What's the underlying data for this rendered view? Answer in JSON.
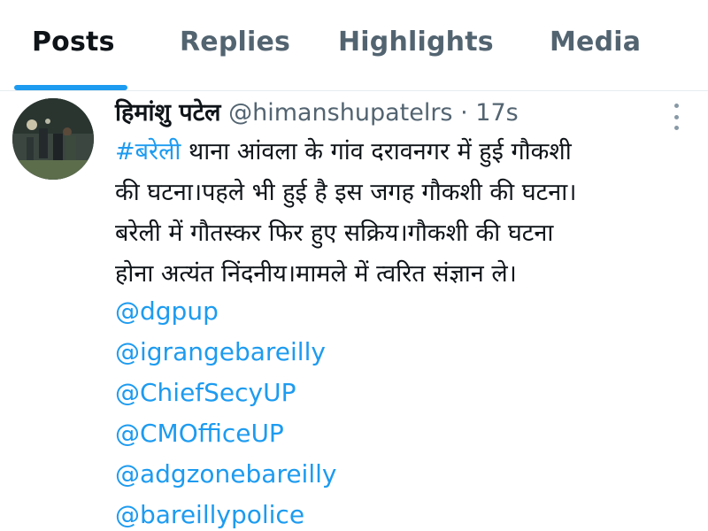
{
  "tabs": [
    {
      "label": "Posts",
      "active": true
    },
    {
      "label": "Replies",
      "active": false
    },
    {
      "label": "Highlights",
      "active": false
    },
    {
      "label": "Media",
      "active": false
    }
  ],
  "tweet": {
    "display_name": "हिमांशु पटेल",
    "handle": "@himanshupatelrs",
    "separator": "·",
    "time": "17s",
    "more_icon": "more-vertical-icon",
    "hashtag": "#बरेली",
    "lines": [
      " थाना आंवला के गांव दरावनगर में हुई गौकशी",
      "की घटना।पहले भी हुई है इस जगह गौकशी की घटना।",
      "बरेली में गौतस्कर फिर हुए सक्रिय।गौकशी की घटना",
      "होना अत्यंत निंदनीय।मामले में त्वरित संज्ञान ले।"
    ],
    "mentions": [
      "@dgpup",
      "@igrangebareilly",
      "@ChiefSecyUP",
      "@CMOfficeUP",
      "@adgzonebareilly",
      "@bareillypolice"
    ]
  },
  "colors": {
    "accent": "#1d9bf0",
    "text_primary": "#0f1419",
    "text_secondary": "#536471"
  }
}
